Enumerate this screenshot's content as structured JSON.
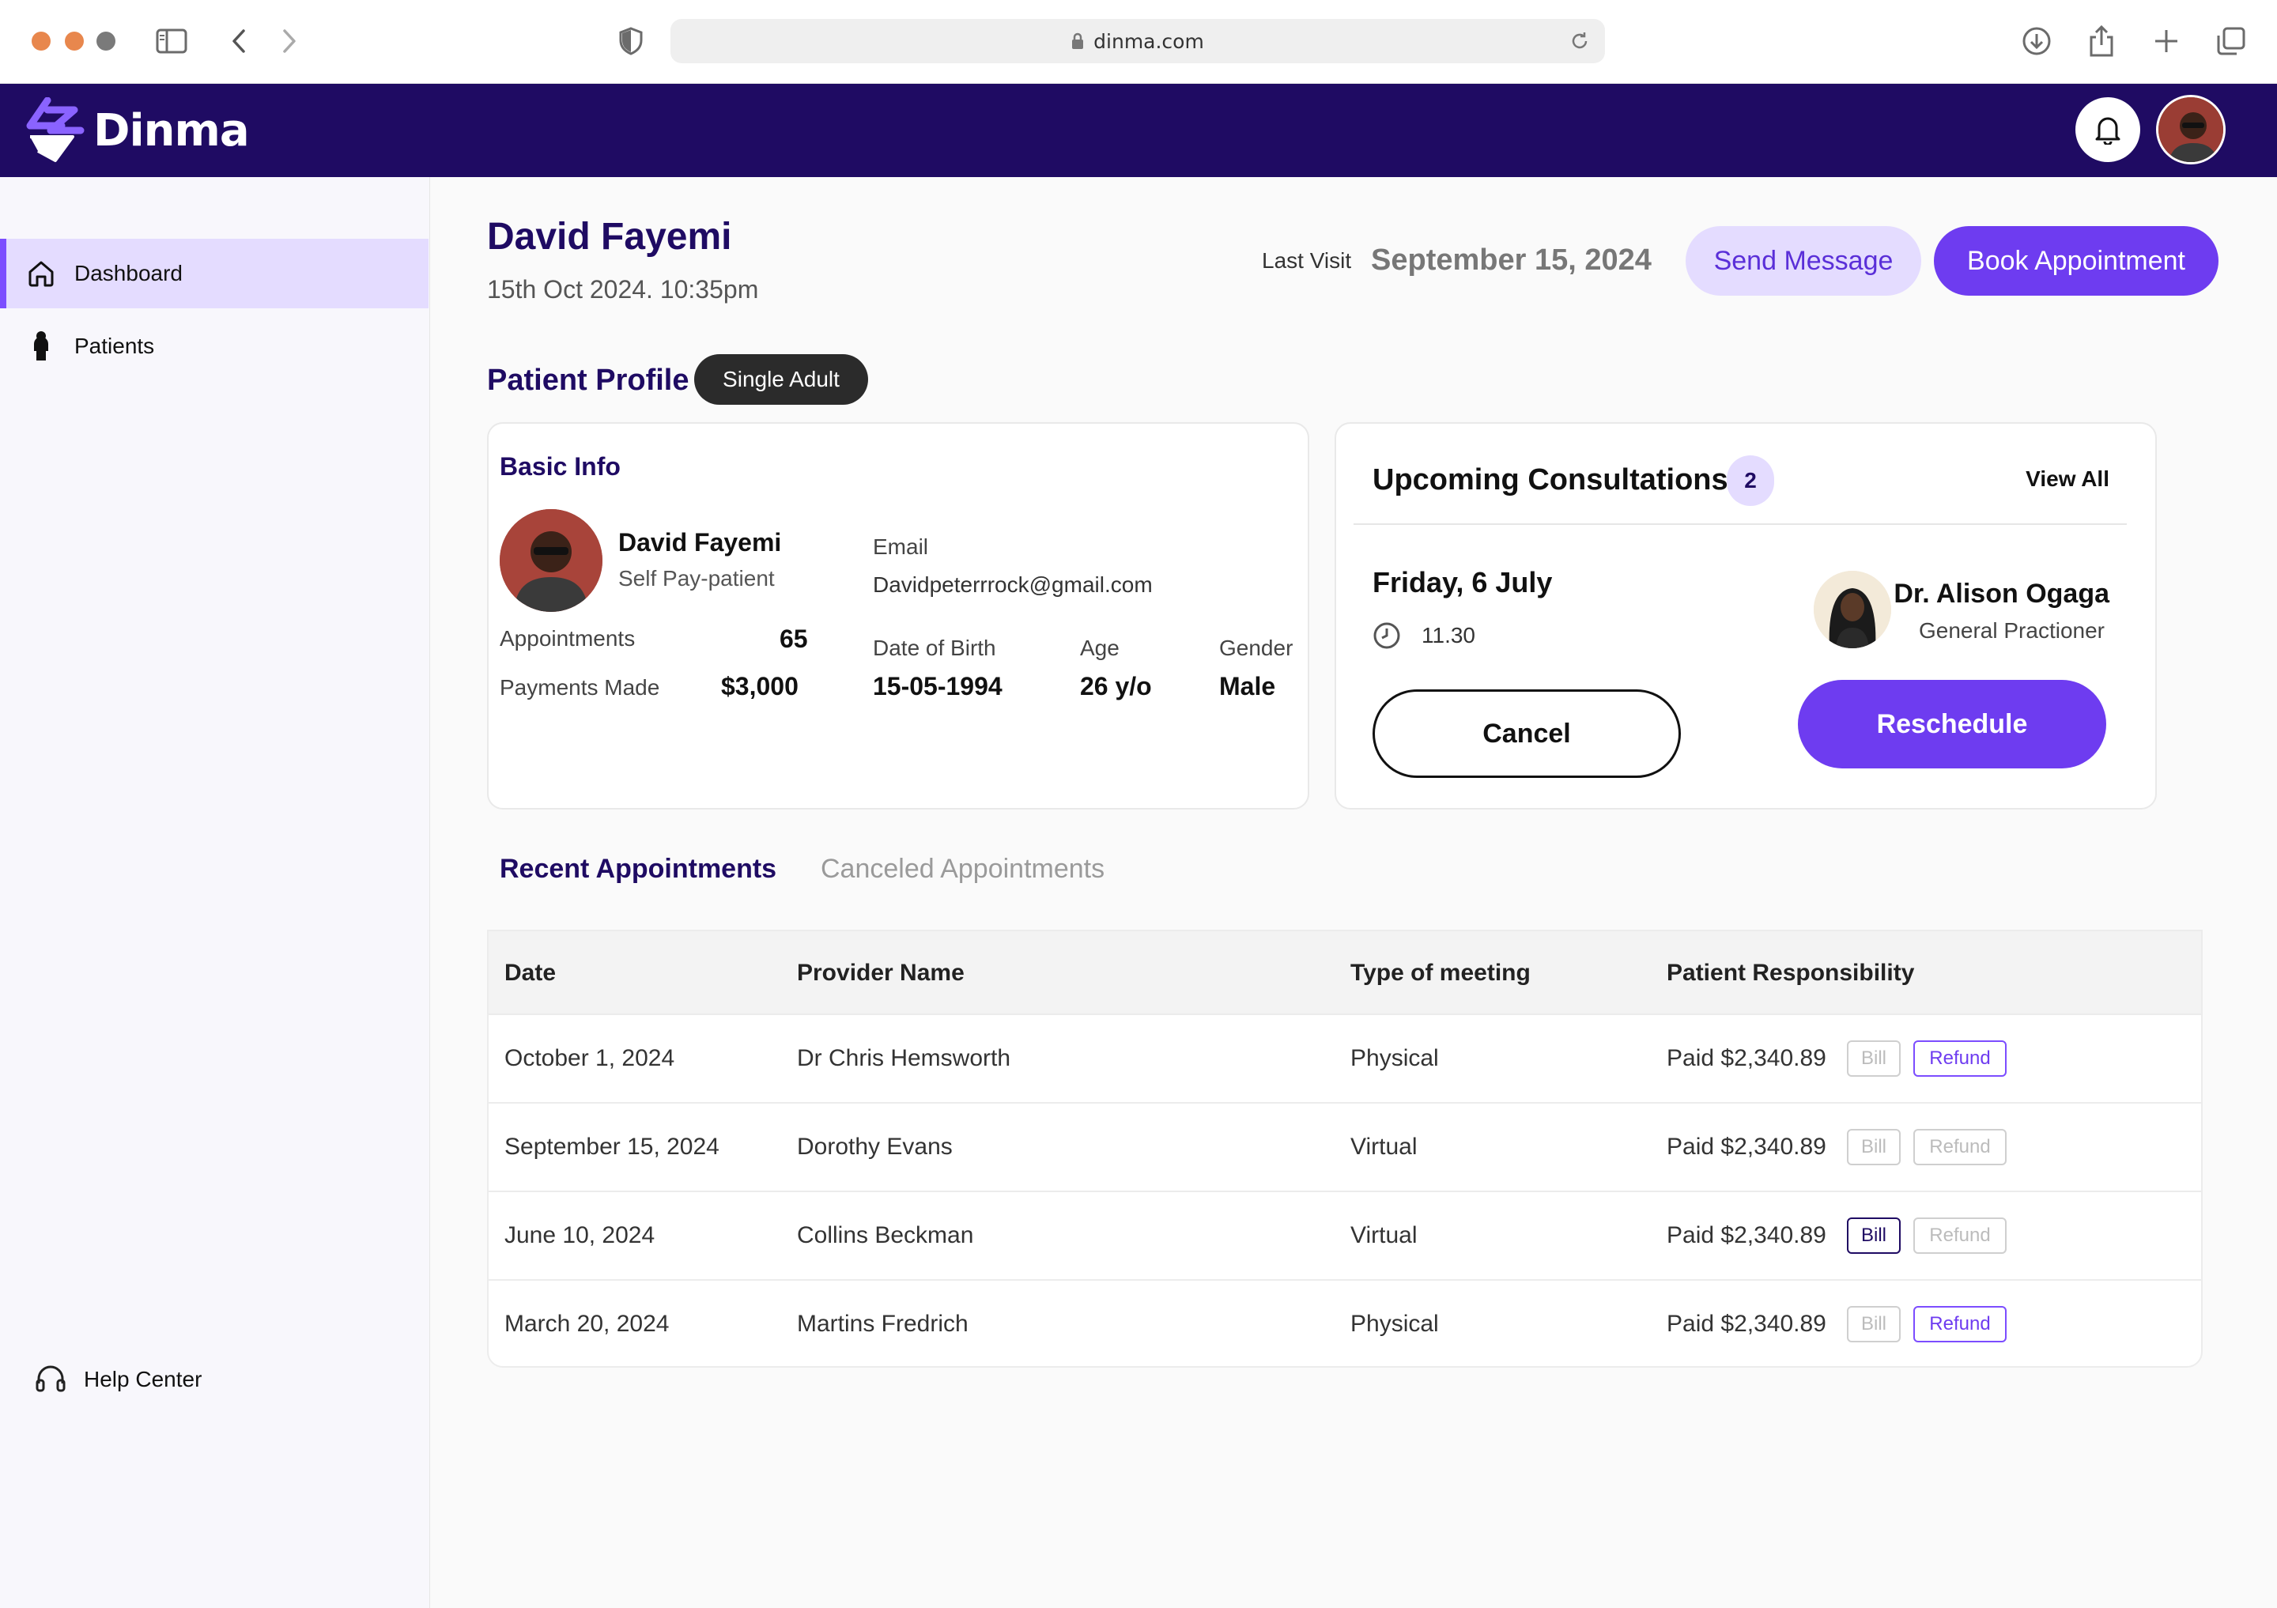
{
  "browser": {
    "url": "dinma.com",
    "traffic_colors": [
      "#e8874d",
      "#e8874d",
      "#7a7a7a"
    ]
  },
  "app": {
    "brand": "Dinma",
    "header_bg": "#1f0b63",
    "accent": "#6e3cf0"
  },
  "sidebar": {
    "items": [
      {
        "label": "Dashboard",
        "icon": "home-icon",
        "active": true
      },
      {
        "label": "Patients",
        "icon": "person-icon",
        "active": false
      }
    ],
    "help": {
      "label": "Help Center",
      "icon": "headset-icon"
    }
  },
  "header": {
    "patient_name": "David Fayemi",
    "datetime": "15th Oct 2024. 10:35pm",
    "last_visit_label": "Last Visit",
    "last_visit_value": "September 15, 2024",
    "send_message": "Send Message",
    "book_appointment": "Book Appointment"
  },
  "profile": {
    "heading": "Patient Profile",
    "badge": "Single Adult",
    "basic_info": {
      "title": "Basic Info",
      "name": "David Fayemi",
      "type": "Self Pay-patient",
      "email_label": "Email",
      "email": "Davidpeterrrock@gmail.com",
      "appointments_label": "Appointments",
      "appointments": "65",
      "payments_label": "Payments Made",
      "payments": "$3,000",
      "dob_label": "Date of Birth",
      "dob": "15-05-1994",
      "age_label": "Age",
      "age": "26 y/o",
      "gender_label": "Gender",
      "gender": "Male"
    }
  },
  "consultations": {
    "title": "Upcoming Consultations",
    "count": "2",
    "view_all": "View All",
    "day": "Friday, 6 July",
    "time": "11.30",
    "doctor_name": "Dr. Alison Ogaga",
    "doctor_role": "General Practioner",
    "cancel": "Cancel",
    "reschedule": "Reschedule"
  },
  "tabs": [
    {
      "label": "Recent Appointments",
      "active": true
    },
    {
      "label": "Canceled Appointments",
      "active": false
    }
  ],
  "table": {
    "headers": [
      "Date",
      "Provider Name",
      "Type of meeting",
      "Patient Responsibility"
    ],
    "bill_label": "Bill",
    "refund_label": "Refund",
    "rows": [
      {
        "date": "October 1, 2024",
        "provider": "Dr Chris Hemsworth",
        "type": "Physical",
        "amount": "Paid $2,340.89",
        "bill_active": false,
        "refund_active": true
      },
      {
        "date": "September 15, 2024",
        "provider": "Dorothy Evans",
        "type": "Virtual",
        "amount": "Paid $2,340.89",
        "bill_active": false,
        "refund_active": false
      },
      {
        "date": "June 10, 2024",
        "provider": "Collins Beckman",
        "type": "Virtual",
        "amount": "Paid $2,340.89",
        "bill_active": true,
        "refund_active": false
      },
      {
        "date": "March 20, 2024",
        "provider": "Martins Fredrich",
        "type": "Physical",
        "amount": "Paid $2,340.89",
        "bill_active": false,
        "refund_active": true
      }
    ]
  }
}
